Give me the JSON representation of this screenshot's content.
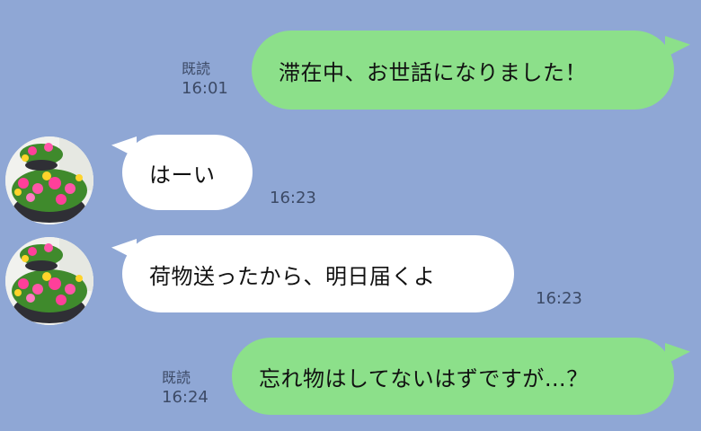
{
  "messages": [
    {
      "side": "out",
      "text": "滞在中、お世話になりました！",
      "read": "既読",
      "time": "16:01"
    },
    {
      "side": "in",
      "text": "はーい",
      "time": "16:23"
    },
    {
      "side": "in",
      "text": "荷物送ったから、明日届くよ",
      "time": "16:23"
    },
    {
      "side": "out",
      "text": "忘れ物はしてないはずですが…？",
      "read": "既読",
      "time": "16:24"
    }
  ],
  "colors": {
    "background": "#8fa7d5",
    "outgoing_bubble": "#8ce08a",
    "incoming_bubble": "#ffffff",
    "meta_text": "#3c4a66"
  }
}
